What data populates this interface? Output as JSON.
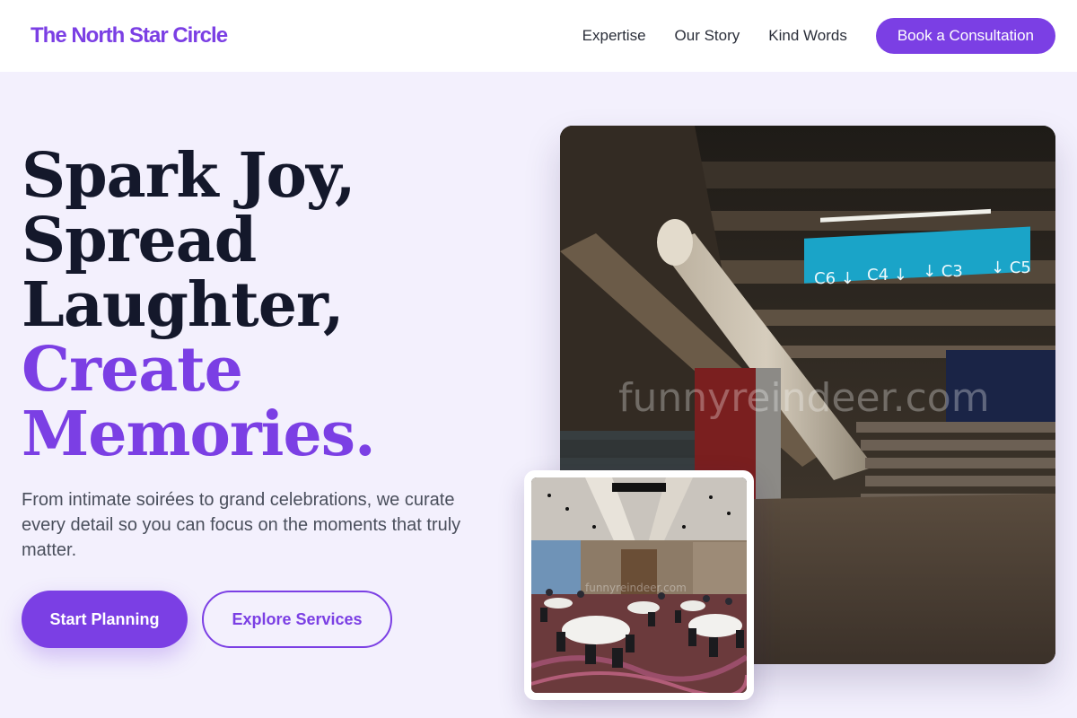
{
  "header": {
    "logo": "The North Star Circle",
    "nav": [
      {
        "label": "Expertise"
      },
      {
        "label": "Our Story"
      },
      {
        "label": "Kind Words"
      }
    ],
    "cta_label": "Book a Consultation"
  },
  "hero": {
    "title_lines": [
      "Spark Joy,",
      "Spread",
      "Laughter,"
    ],
    "title_accent_lines": [
      "Create",
      "Memories."
    ],
    "subtitle": "From intimate soirées to grand celebrations, we curate every detail so you can focus on the moments that truly matter.",
    "primary_button": "Start Planning",
    "secondary_button": "Explore Services"
  },
  "images": {
    "main_watermark": "funnyreindeer.com",
    "main_signs": [
      "C6 ↓",
      "C4 ↓",
      "↓ C3",
      "↓ C5"
    ],
    "inset_watermark": "funnyreindeer.com"
  },
  "colors": {
    "accent": "#7b3fe4",
    "background": "#f3f0fd",
    "heading": "#14182b"
  }
}
